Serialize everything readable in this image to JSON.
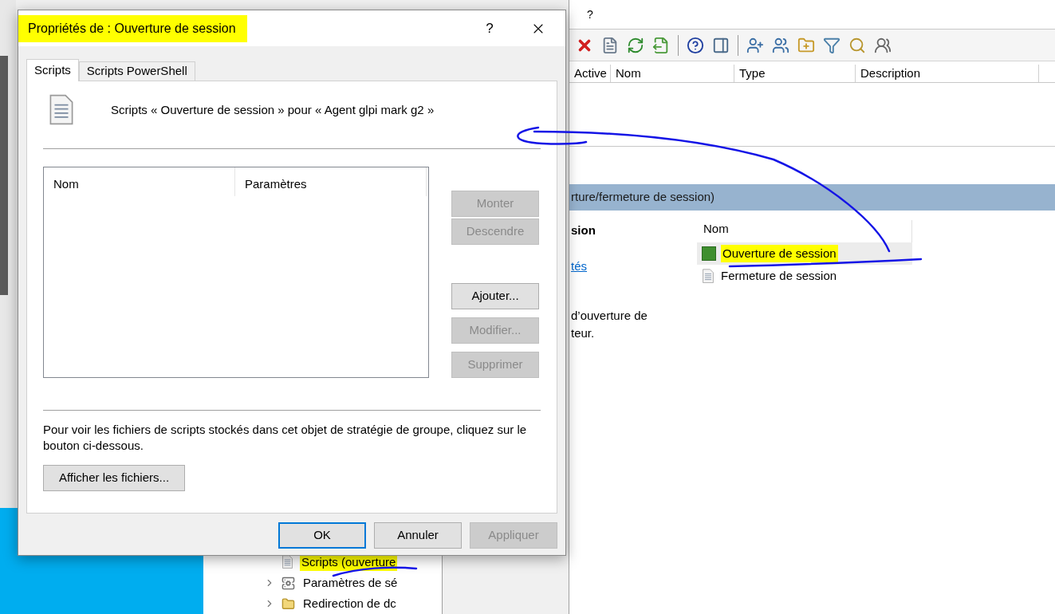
{
  "background_window": {
    "menu": [
      "?"
    ],
    "column_headers": [
      "Active",
      "Nom",
      "Type",
      "Description"
    ],
    "section_title": "rture/fermeture de session)",
    "left_pane": {
      "heading": "sion",
      "link": "tés",
      "text_lines": [
        "d’ouverture de",
        "teur."
      ]
    },
    "list": {
      "column": "Nom",
      "items": [
        {
          "label": "Ouverture de session",
          "selected": true,
          "kind": "active"
        },
        {
          "label": "Fermeture de session",
          "selected": false,
          "kind": "script"
        }
      ]
    },
    "tree": [
      {
        "label": "Scripts (ouverture",
        "kind": "script",
        "expandable": false,
        "highlighted": true
      },
      {
        "label": "Paramètres de sé",
        "kind": "security",
        "expandable": true,
        "highlighted": false
      },
      {
        "label": "Redirection de dc",
        "kind": "folder",
        "expandable": true,
        "highlighted": false
      }
    ]
  },
  "dialog": {
    "title": "Propriétés de : Ouverture de session",
    "title_highlighted": true,
    "help": "?",
    "tabs": [
      {
        "label": "Scripts",
        "selected": true
      },
      {
        "label": "Scripts PowerShell",
        "selected": false
      }
    ],
    "header_text": "Scripts « Ouverture de session » pour « Agent glpi mark g2 »",
    "table": {
      "columns": [
        "Nom",
        "Paramètres"
      ]
    },
    "side_buttons": [
      {
        "label": "Monter",
        "disabled": true
      },
      {
        "label": "Descendre",
        "disabled": true
      },
      {
        "label": "Ajouter...",
        "disabled": false
      },
      {
        "label": "Modifier...",
        "disabled": true
      },
      {
        "label": "Supprimer",
        "disabled": true
      }
    ],
    "note": "Pour voir les fichiers de scripts stockés dans cet objet de stratégie de groupe, cliquez sur le bouton ci-dessous.",
    "show_files_button": "Afficher les fichiers...",
    "footer_buttons": [
      {
        "label": "OK",
        "default": true,
        "disabled": false
      },
      {
        "label": "Annuler",
        "default": false,
        "disabled": false
      },
      {
        "label": "Appliquer",
        "default": false,
        "disabled": true
      }
    ]
  }
}
